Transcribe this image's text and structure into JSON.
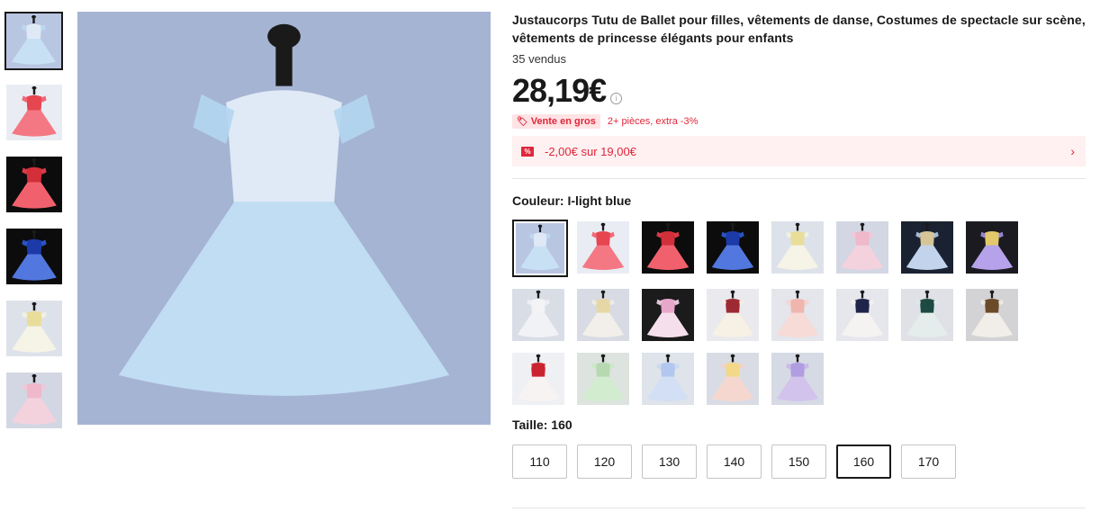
{
  "product": {
    "title": "Justaucorps Tutu de Ballet pour filles, vêtements de danse, Costumes de spectacle sur scène, vêtements de princesse élégants pour enfants",
    "sold": "35 vendus",
    "price": "28,19€",
    "bulk_badge": "Vente en gros",
    "bulk_text": "2+ pièces, extra -3%",
    "coupon_text": "-2,00€ sur 19,00€",
    "color_label": "Couleur: I-light blue",
    "size_label": "Taille: 160",
    "sizes": [
      "110",
      "120",
      "130",
      "140",
      "150",
      "160",
      "170"
    ],
    "selected_size": "160"
  },
  "thumbnails": [
    {
      "bg": "#b9c6e2",
      "dress": "#bcd9f2",
      "bodice": "#dfe9f6",
      "name": "light-blue"
    },
    {
      "bg": "#e9edf3",
      "dress": "#f25b6a",
      "bodice": "#e6464f",
      "name": "red-gold"
    },
    {
      "bg": "#0c0c0c",
      "dress": "#ee3f4d",
      "bodice": "#d22f3a",
      "name": "red-black"
    },
    {
      "bg": "#0c0c0c",
      "dress": "#2c5bd8",
      "bodice": "#1c3aa8",
      "name": "royal-blue"
    },
    {
      "bg": "#dde2ea",
      "dress": "#f5f1e2",
      "bodice": "#e9dd9a",
      "name": "cream"
    },
    {
      "bg": "#d3d7e3",
      "dress": "#f2c8d6",
      "bodice": "#efb8cb",
      "name": "pink"
    }
  ],
  "swatches": [
    {
      "bg": "#b9c6e2",
      "dress": "#bcd9f2",
      "bodice": "#dfe9f6"
    },
    {
      "bg": "#e9edf3",
      "dress": "#f25b6a",
      "bodice": "#e6464f"
    },
    {
      "bg": "#0c0c0c",
      "dress": "#ee3f4d",
      "bodice": "#d22f3a"
    },
    {
      "bg": "#0c0c0c",
      "dress": "#2c5bd8",
      "bodice": "#1c3aa8"
    },
    {
      "bg": "#dde2ea",
      "dress": "#f5f1e2",
      "bodice": "#e9dd9a"
    },
    {
      "bg": "#d3d7e3",
      "dress": "#f2c8d6",
      "bodice": "#efb8cb"
    },
    {
      "bg": "#1a2232",
      "dress": "#b5cbe8",
      "bodice": "#d6c596"
    },
    {
      "bg": "#1a1a20",
      "dress": "#a58ee6",
      "bodice": "#e2c86a"
    },
    {
      "bg": "#d9dde6",
      "dress": "#eef0f5",
      "bodice": "#f3f3f6"
    },
    {
      "bg": "#d8dbe4",
      "dress": "#f0ece6",
      "bodice": "#e6d8a6"
    },
    {
      "bg": "#1b1b1b",
      "dress": "#f5d8ea",
      "bodice": "#e9a6cb"
    },
    {
      "bg": "#e9e9ee",
      "dress": "#f5ede0",
      "bodice": "#9e2a33"
    },
    {
      "bg": "#e4e6ec",
      "dress": "#f5d3cf",
      "bodice": "#efb6b0"
    },
    {
      "bg": "#e6e7ec",
      "dress": "#f3f1ef",
      "bodice": "#1f254a"
    },
    {
      "bg": "#dfe1e6",
      "dress": "#dfe9e7",
      "bodice": "#1e4a44"
    },
    {
      "bg": "#d3d3d6",
      "dress": "#eeeae3",
      "bodice": "#6b4a2a"
    },
    {
      "bg": "#eef0f3",
      "dress": "#f7f1f1",
      "bodice": "#cc2330"
    },
    {
      "bg": "#dde3de",
      "dress": "#c9e8c5",
      "bodice": "#b6d9b2"
    },
    {
      "bg": "#dfe3ea",
      "dress": "#c9d8f2",
      "bodice": "#b3c6ee"
    },
    {
      "bg": "#d9dce4",
      "dress": "#f5cfc6",
      "bodice": "#f2d889"
    },
    {
      "bg": "#d6dae4",
      "dress": "#c9b6ea",
      "bodice": "#b09ee0"
    }
  ],
  "main_image": {
    "bg": "#a6b4d3",
    "dress": "#b4d6f1",
    "bodice": "#dfeaf6"
  }
}
